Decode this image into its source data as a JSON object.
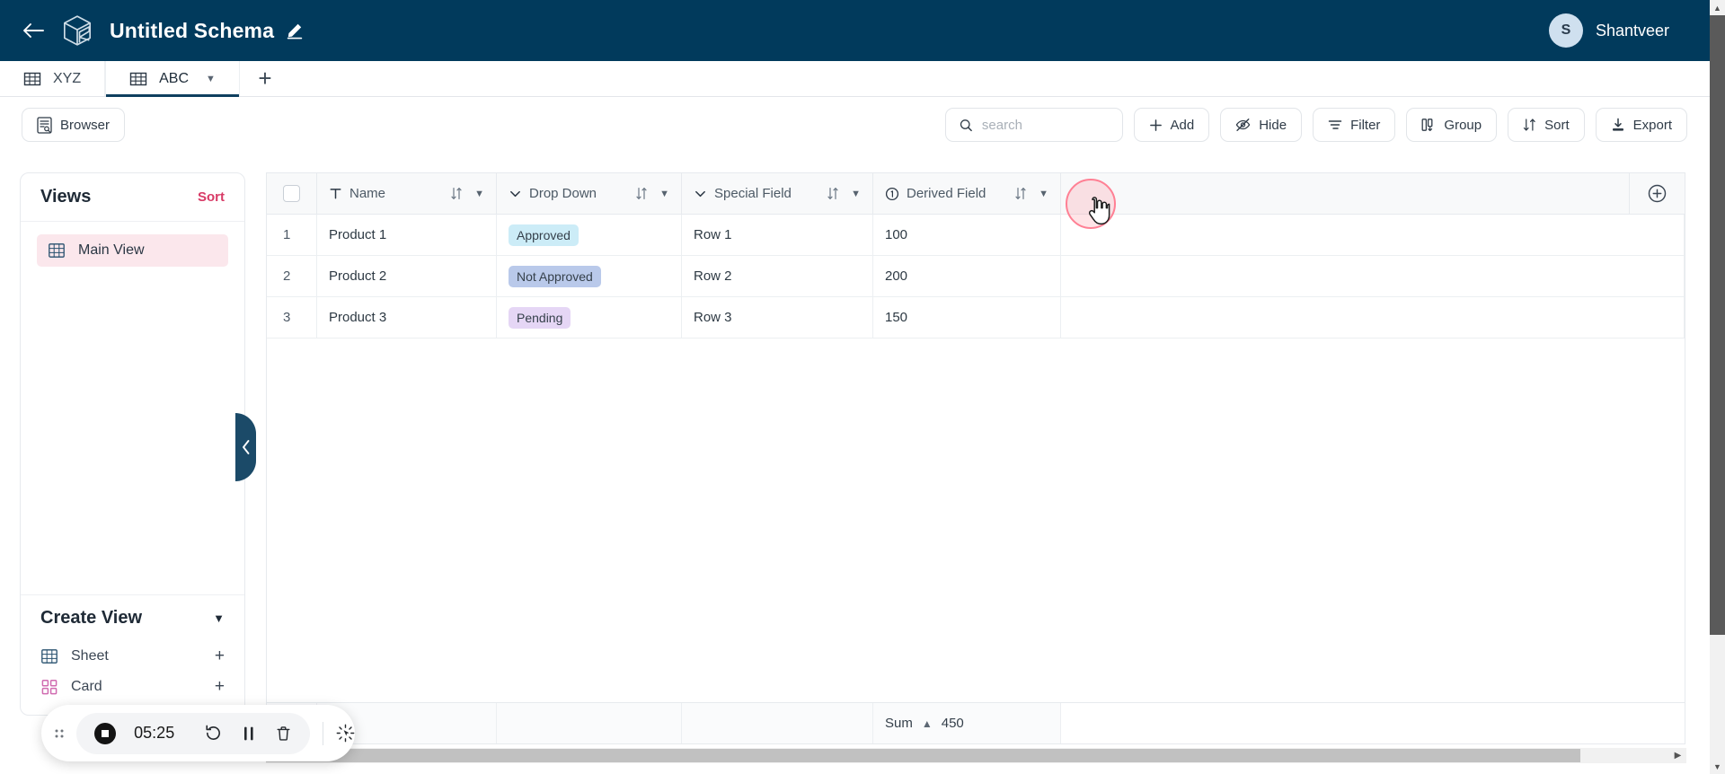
{
  "topbar": {
    "back_icon": "arrow-left-icon",
    "logo_icon": "cube-logo-icon",
    "title": "Untitled Schema",
    "edit_icon": "pencil-icon",
    "user": {
      "initial": "S",
      "name": "Shantveer"
    }
  },
  "tabs": {
    "items": [
      {
        "label": "XYZ",
        "icon": "table-icon",
        "active": false
      },
      {
        "label": "ABC",
        "icon": "table-icon",
        "active": true,
        "chevron": "chevron-down-icon"
      }
    ],
    "add_label": "+"
  },
  "toolbar": {
    "browser_label": "Browser",
    "browser_icon": "browser-document-icon",
    "search": {
      "value": "",
      "placeholder": "search",
      "icon": "search-icon"
    },
    "buttons": [
      {
        "label": "Add",
        "icon": "plus-icon"
      },
      {
        "label": "Hide",
        "icon": "eye-off-icon"
      },
      {
        "label": "Filter",
        "icon": "filter-icon"
      },
      {
        "label": "Group",
        "icon": "group-icon"
      },
      {
        "label": "Sort",
        "icon": "sort-icon"
      },
      {
        "label": "Export",
        "icon": "download-icon"
      }
    ]
  },
  "sidebar": {
    "views_title": "Views",
    "sort_label": "Sort",
    "views": [
      {
        "label": "Main View",
        "icon": "grid-view-icon",
        "selected": true
      }
    ],
    "create_title": "Create View",
    "create_chevron": "chevron-down-icon",
    "create_items": [
      {
        "label": "Sheet",
        "icon": "grid-view-icon",
        "action": "+"
      },
      {
        "label": "Card",
        "icon": "card-view-icon",
        "action": "+"
      }
    ],
    "collapse_icon": "chevron-left-icon"
  },
  "table": {
    "select_all_icon": "checkbox-icon",
    "add_column_icon": "plus-circle-icon",
    "columns": [
      {
        "label": "Name",
        "type_icon": "text-type-icon",
        "sort_icon": "sort-arrows-icon",
        "menu_icon": "chevron-down-icon"
      },
      {
        "label": "Drop Down",
        "type_icon": "chevron-down-icon",
        "sort_icon": "sort-arrows-icon",
        "menu_icon": "chevron-down-icon"
      },
      {
        "label": "Special Field",
        "type_icon": "chevron-down-icon",
        "sort_icon": "sort-arrows-icon",
        "menu_icon": "chevron-down-icon"
      },
      {
        "label": "Derived Field",
        "type_icon": "number-circle-icon",
        "sort_icon": "sort-arrows-icon",
        "menu_icon": "chevron-down-icon"
      }
    ],
    "rows": [
      {
        "num": "1",
        "name": "Product 1",
        "drop_down": "Approved",
        "badge_color": "#ccecf7",
        "special": "Row 1",
        "derived": "100"
      },
      {
        "num": "2",
        "name": "Product 2",
        "drop_down": "Not Approved",
        "badge_color": "#b9c9ea",
        "special": "Row 2",
        "derived": "200"
      },
      {
        "num": "3",
        "name": "Product 3",
        "drop_down": "Pending",
        "badge_color": "#e5d6f5",
        "special": "Row 3",
        "derived": "150"
      }
    ],
    "footer": {
      "agg_label": "Sum",
      "agg_icon": "chevron-up-icon",
      "agg_value": "450"
    }
  },
  "recorder": {
    "drag_icon": "drag-handle-icon",
    "stop_icon": "stop-record-icon",
    "time": "05:25",
    "restart_icon": "restart-icon",
    "pause_icon": "pause-icon",
    "delete_icon": "trash-icon",
    "highlight_icon": "cursor-highlight-icon"
  },
  "colors": {
    "brand_dark": "#013a5c",
    "accent_pink": "#d83a66",
    "selected_row_bg": "#fbe7ec",
    "handle_blue": "#1b4a68",
    "halo": "#ff8094"
  }
}
